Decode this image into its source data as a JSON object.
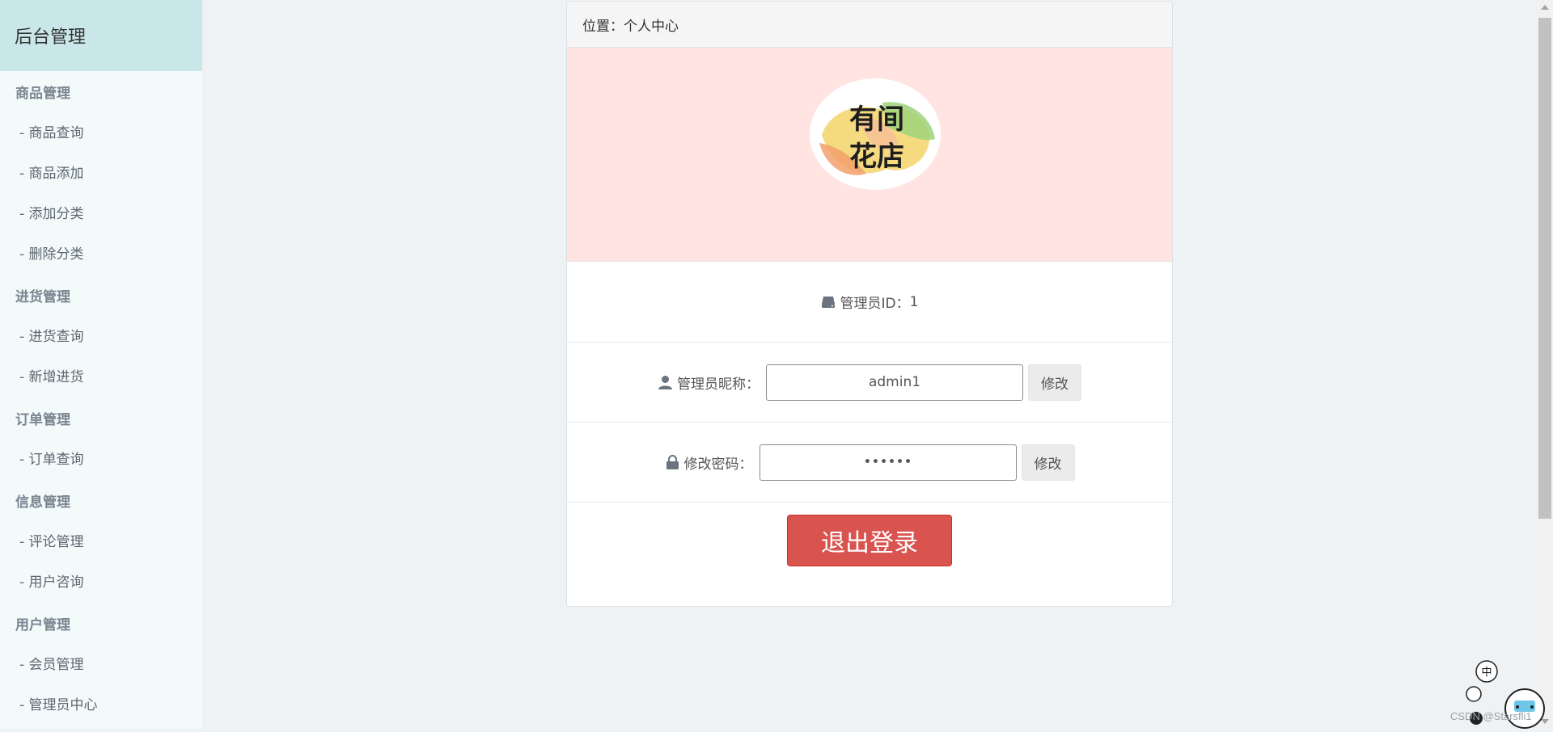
{
  "sidebar": {
    "title": "后台管理",
    "groups": [
      {
        "label": "商品管理",
        "items": [
          "- 商品查询",
          "- 商品添加",
          "- 添加分类",
          "- 删除分类"
        ]
      },
      {
        "label": "进货管理",
        "items": [
          "- 进货查询",
          "- 新增进货"
        ]
      },
      {
        "label": "订单管理",
        "items": [
          "- 订单查询"
        ]
      },
      {
        "label": "信息管理",
        "items": [
          "- 评论管理",
          "- 用户咨询"
        ]
      },
      {
        "label": "用户管理",
        "items": [
          "- 会员管理",
          "- 管理员中心"
        ]
      }
    ]
  },
  "panel": {
    "location": "位置：个人中心",
    "logo_text": [
      "有间",
      "花店"
    ],
    "admin_id_label": "管理员ID：",
    "admin_id_value": "1",
    "nickname_label": "管理员昵称：",
    "nickname_value": "admin1",
    "nickname_button": "修改",
    "password_label": "修改密码：",
    "password_value": "••••••",
    "password_button": "修改",
    "logout_button": "退出登录"
  },
  "overlay": {
    "watermark": "CSDN @Starsfli1",
    "ime_label": "中"
  },
  "colors": {
    "sidebar_header": "#c9e6e8",
    "sidebar_bg": "#f3fafa",
    "logo_area": "#ffe4e1",
    "logout_button": "#d9534f"
  }
}
